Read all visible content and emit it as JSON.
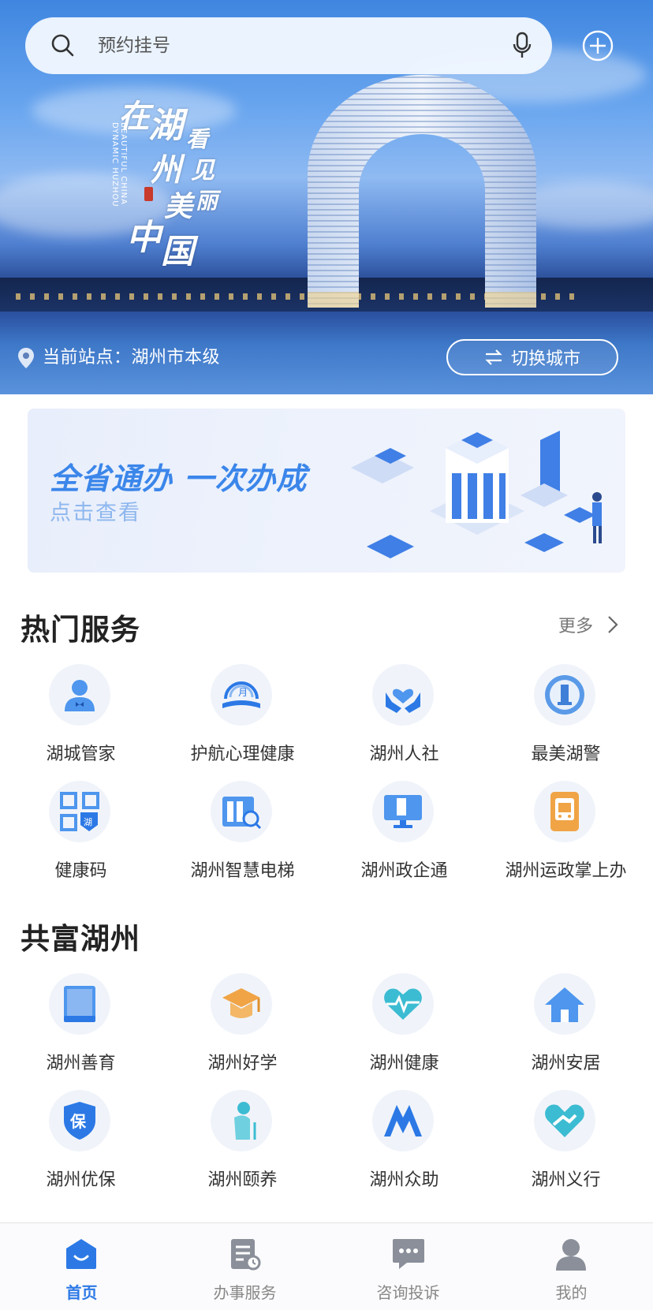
{
  "search": {
    "placeholder": "预约挂号"
  },
  "hero": {
    "location_label": "当前站点：湖州市本级",
    "switch_label": "切换城市",
    "calligraphy": [
      "在",
      "湖",
      "州",
      "看",
      "见",
      "美",
      "丽",
      "中",
      "国"
    ],
    "calligraphy_en": "BEAUTIFUL CHINA DYNAMIC HUZHOU"
  },
  "banner": {
    "title": "全省通办 一次办成",
    "subtitle": "点击查看"
  },
  "hot": {
    "title": "热门服务",
    "more": "更多",
    "items": [
      {
        "label": "湖城管家",
        "icon": "butler-person-icon"
      },
      {
        "label": "护航心理健康",
        "icon": "mental-health-logo-icon"
      },
      {
        "label": "湖州人社",
        "icon": "hands-heart-icon"
      },
      {
        "label": "最美湖警",
        "icon": "police-badge-icon"
      },
      {
        "label": "健康码",
        "icon": "health-qr-code-icon"
      },
      {
        "label": "湖州智慧电梯",
        "icon": "elevator-search-icon"
      },
      {
        "label": "湖州政企通",
        "icon": "computer-monitor-icon"
      },
      {
        "label": "湖州运政掌上办",
        "icon": "bus-phone-icon"
      }
    ]
  },
  "gongfu": {
    "title": "共富湖州",
    "items": [
      {
        "label": "湖州善育",
        "icon": "book-icon"
      },
      {
        "label": "湖州好学",
        "icon": "graduation-cap-icon"
      },
      {
        "label": "湖州健康",
        "icon": "heart-pulse-icon"
      },
      {
        "label": "湖州安居",
        "icon": "house-icon"
      },
      {
        "label": "湖州优保",
        "icon": "insurance-shield-icon"
      },
      {
        "label": "湖州颐养",
        "icon": "elderly-person-icon"
      },
      {
        "label": "湖州众助",
        "icon": "mutual-aid-icon"
      },
      {
        "label": "湖州义行",
        "icon": "heart-hands-icon"
      }
    ]
  },
  "tabs": [
    {
      "label": "首页",
      "icon": "home-icon",
      "active": true
    },
    {
      "label": "办事服务",
      "icon": "document-clock-icon",
      "active": false
    },
    {
      "label": "咨询投诉",
      "icon": "chat-bubble-icon",
      "active": false
    },
    {
      "label": "我的",
      "icon": "user-icon",
      "active": false
    }
  ],
  "colors": {
    "accent": "#2c79e6",
    "banner_title": "#3b86ea",
    "banner_subtitle": "#8eb7ee"
  }
}
